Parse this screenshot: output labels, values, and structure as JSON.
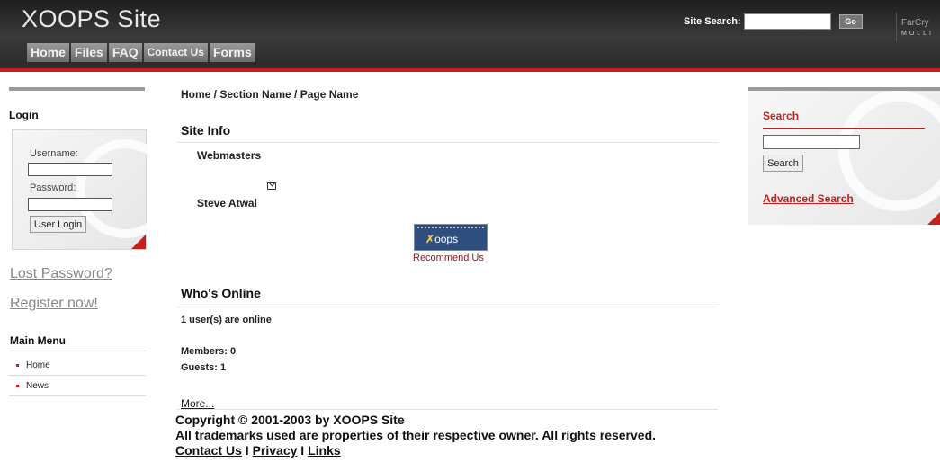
{
  "header": {
    "site_title": "XOOPS Site",
    "nav": [
      "Home",
      "Files",
      "FAQ",
      "Contact Us",
      "Forms"
    ],
    "site_search_label": "Site Search:",
    "go_label": "Go",
    "logo_top": "FarCry",
    "logo_bottom": "MOLLI"
  },
  "left": {
    "login_title": "Login",
    "username_label": "Username:",
    "password_label": "Password:",
    "login_button": "User Login",
    "lost_password": "Lost Password?",
    "register": "Register now!",
    "main_menu_title": "Main Menu",
    "menu_items": [
      "Home",
      "News"
    ]
  },
  "center": {
    "breadcrumb": "Home / Section Name / Page Name",
    "site_info_title": "Site Info",
    "webmasters_label": "Webmasters",
    "webmaster_name": "Steve Atwal",
    "badge_text": "oops",
    "recommend_link": "Recommend Us",
    "whos_online_title": "Who's Online",
    "users_online": "1 user(s) are online",
    "members": "Members: 0",
    "guests": "Guests: 1",
    "more_link": "More..."
  },
  "footer": {
    "copyright": "Copyright © 2001-2003 by XOOPS Site",
    "trademarks": "All trademarks used are properties of their respective owner. All rights reserved.",
    "links": [
      "Contact Us",
      "Privacy",
      "Links"
    ],
    "separator": " I "
  },
  "right": {
    "search_title": "Search",
    "search_button": "Search",
    "advanced_search": "Advanced Search"
  },
  "colors": {
    "accent_red": "#c81e1e",
    "header_dark": "#2a2a2a",
    "tab_grey": "#8a8a8a"
  }
}
